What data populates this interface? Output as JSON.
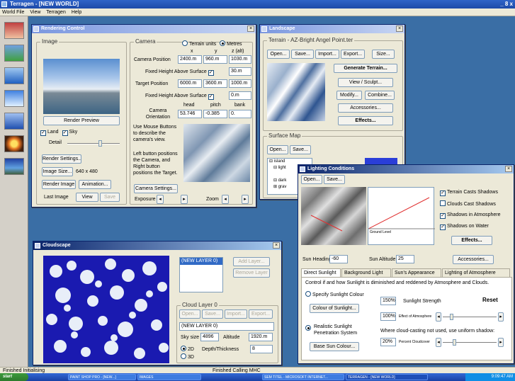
{
  "app": {
    "title": "Terragen - [NEW WORLD]",
    "controls": "_ 8 x"
  },
  "menu": [
    "World File",
    "View",
    "Terragen",
    "Help"
  ],
  "rendering": {
    "title": "Rendering Control",
    "image_group": "Image",
    "render_preview": "Render Preview",
    "land": "Land",
    "sky": "Sky",
    "detail": "Detail",
    "render_settings": "Render Settings...",
    "image_size_btn": "Image Size...",
    "image_size_value": "640 x 480",
    "render_image": "Render Image",
    "animation": "Animation...",
    "last_image": "Last Image",
    "view": "View",
    "save": "Save",
    "camera_group": "Camera",
    "terrain_units": "Terrain units",
    "metres": "Metres",
    "col_x": "x",
    "col_y": "y",
    "col_z": "z (alt)",
    "camera_position": "Camera Position",
    "cam_x": "2400.m",
    "cam_y": "960.m",
    "cam_z": "1030.m",
    "fixed_height_1": "Fixed Height Above Surface",
    "fh1_value": "30.m",
    "target_position": "Target Position",
    "tgt_x": "6000.m",
    "tgt_y": "3600.m",
    "tgt_z": "1000.m",
    "fixed_height_2": "Fixed Height Above Surface",
    "fh2_value": "0.m",
    "head": "head",
    "pitch": "pitch",
    "bank": "bank",
    "camera_orientation": "Camera Orientation",
    "orient_head": "53.746",
    "orient_pitch": "-0.385",
    "orient_bank": "0.",
    "help_text_1": "Use Mouse Buttons to describe the camera's view.",
    "help_text_2": "Left button positions the Camera, and Right button positions the Target.",
    "camera_settings": "Camera Settings...",
    "exposure": "Exposure",
    "zoom": "Zoom"
  },
  "landscape": {
    "title": "Landscape",
    "terrain_group": "Terrain - AZ-Bright Angel Point.ter",
    "open": "Open...",
    "save": "Save...",
    "import": "Import...",
    "export": "Export...",
    "size": "Size...",
    "generate_terrain": "Generate Terrain...",
    "view_sculpt": "View / Sculpt...",
    "modify": "Modify...",
    "combine": "Combine...",
    "accessories": "Accessories...",
    "effects": "Effects...",
    "surface_map_group": "Surface Map",
    "sm_open": "Open...",
    "sm_save": "Save...",
    "tree": [
      "island",
      "light",
      "dark",
      "grav"
    ]
  },
  "lighting": {
    "title": "Lighting Conditions",
    "open": "Open...",
    "save": "Save...",
    "ground_level": "Ground Level",
    "terrain_casts_shadows": "Terrain Casts Shadows",
    "clouds_cast_shadows": "Clouds Cast Shadows",
    "shadows_in_atmosphere": "Shadows in Atmosphere",
    "shadows_on_water": "Shadows on Water",
    "effects": "Effects...",
    "accessories": "Accessories...",
    "sun_heading_label": "Sun Heading",
    "sun_heading_value": "-60",
    "sun_altitude_label": "Sun Altitude",
    "sun_altitude_value": "25",
    "tabs": [
      "Direct Sunlight",
      "Background Light",
      "Sun's Appearance",
      "Lighting of Atmosphere"
    ],
    "desc": "Control if and how Sunlight is diminished and reddened by Atmosphere and Clouds.",
    "specify_colour": "Specify Sunlight Colour",
    "colour_btn": "Colour of Sunlight...",
    "strength_value": "150%",
    "strength_label": "Sunlight Strength",
    "reset": "Reset",
    "effect_value": "100%",
    "effect_label": "Effect of Atmosphere",
    "realistic": "Realistic Sunlight Penetration System",
    "where_text": "Where cloud-casting not used, use uniform shadow:",
    "base_sun_colour": "Base Sun Colour...",
    "cloud_value": "20%",
    "cloud_label": "Percent Cloudcover"
  },
  "cloudscape": {
    "title": "Cloudscape",
    "layer_item": "(NEW LAYER 0)",
    "add_layer": "Add Layer...",
    "remove_layer": "Remove Layer",
    "cloud_layer_group": "Cloud Layer 0",
    "open": "Open...",
    "save": "Save...",
    "import": "Import...",
    "export": "Export...",
    "layer_name": "(NEW LAYER 0)",
    "sky_size_label": "Sky size",
    "sky_size_value": "4896",
    "altitude_label": "Altitude",
    "altitude_value": "1920.m",
    "opt_2d": "2D",
    "opt_3d": "3D",
    "depth_label": "Depth/Thickness",
    "depth_value": "8"
  },
  "status": {
    "left": "Finished Initialising",
    "right": "Finished Calling MHC"
  },
  "taskbar": {
    "start": "start",
    "items": [
      "PAINT SHOP PRO - [NEW...]",
      "IMAGES",
      "SEM TITEL - MICROSOFT INTERNET...",
      "TERRAGEN - [NEW WORLD]"
    ],
    "clock": "9:09:47 AM"
  },
  "colors": {
    "desktop": "#3a6ea5",
    "cloud_blue": "#1a1ab0"
  }
}
